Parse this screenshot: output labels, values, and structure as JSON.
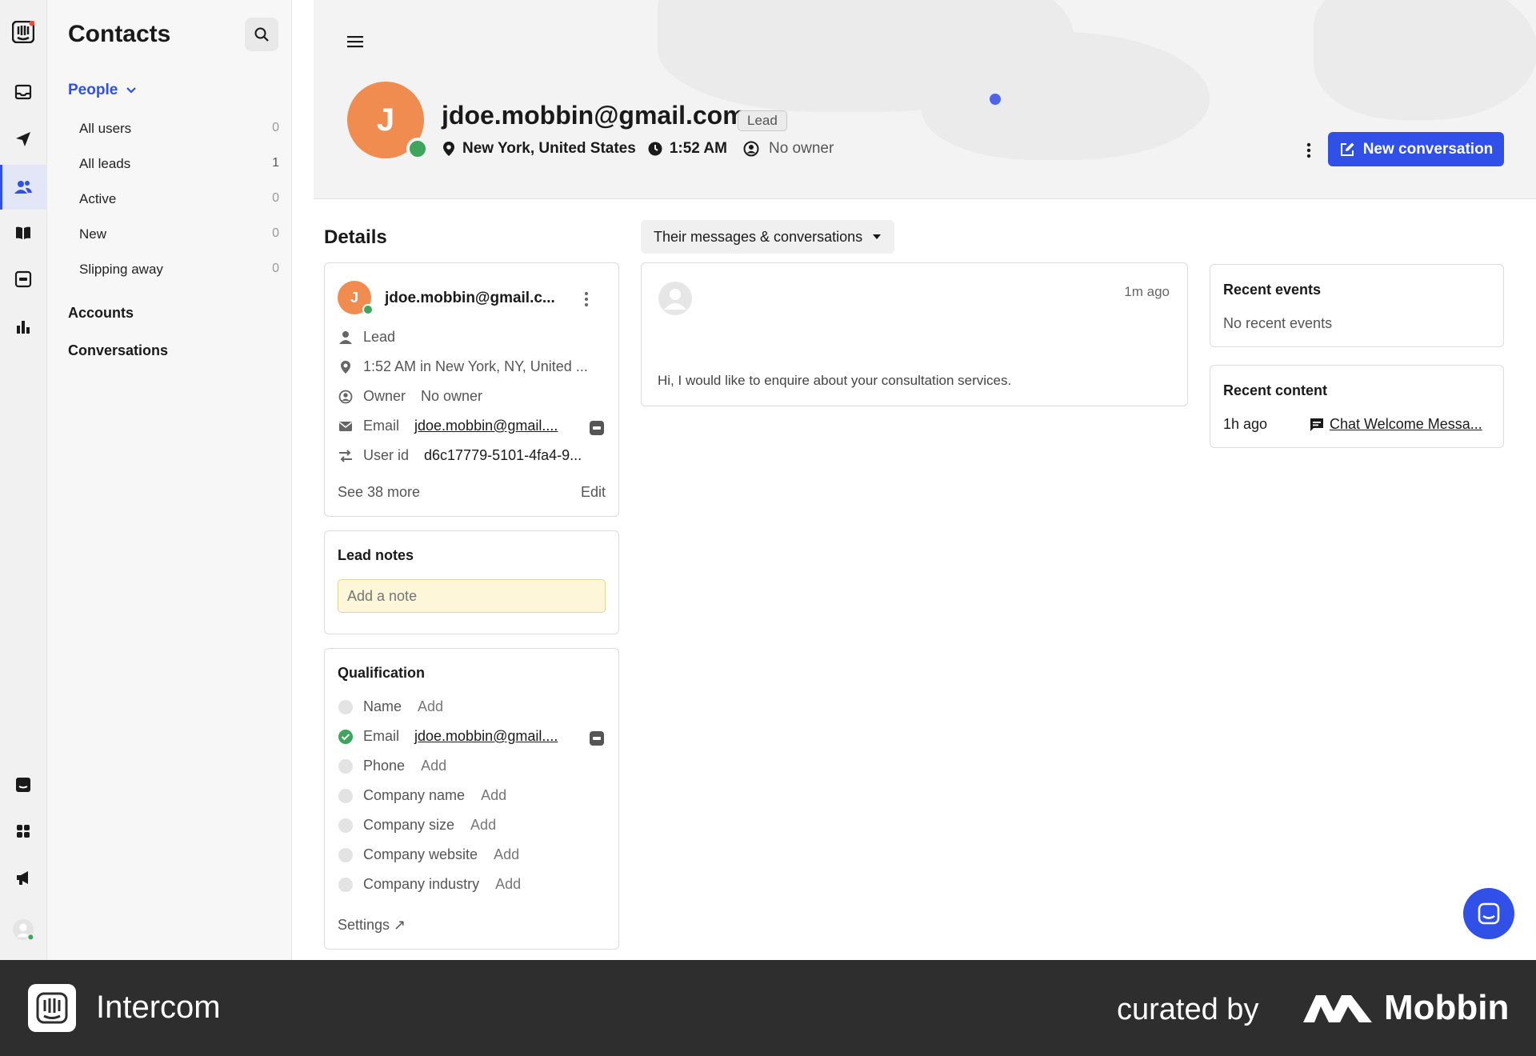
{
  "sidebar": {
    "title": "Contacts",
    "people_label": "People",
    "items": [
      {
        "label": "All users",
        "count": "0"
      },
      {
        "label": "All leads",
        "count": "1"
      },
      {
        "label": "Active",
        "count": "0"
      },
      {
        "label": "New",
        "count": "0"
      },
      {
        "label": "Slipping away",
        "count": "0"
      }
    ],
    "sections": [
      "Accounts",
      "Conversations"
    ]
  },
  "header": {
    "avatar_initial": "J",
    "email": "jdoe.mobbin@gmail.com",
    "badge": "Lead",
    "location": "New York, United States",
    "time": "1:52 AM",
    "owner": "No owner",
    "new_conversation": "New conversation"
  },
  "details": {
    "title": "Details",
    "card": {
      "initial": "J",
      "name": "jdoe.mobbin@gmail.c...",
      "type": "Lead",
      "location": "1:52 AM in New York, NY, United ...",
      "owner_label": "Owner",
      "owner_value": "No owner",
      "email_label": "Email",
      "email_value": "jdoe.mobbin@gmail....",
      "userid_label": "User id",
      "userid_value": "d6c17779-5101-4fa4-9...",
      "see_more": "See 38 more",
      "edit": "Edit"
    },
    "notes": {
      "title": "Lead notes",
      "placeholder": "Add a note"
    },
    "qualification": {
      "title": "Qualification",
      "rows": [
        {
          "label": "Name",
          "value": "Add"
        },
        {
          "label": "Email",
          "value": "jdoe.mobbin@gmail...."
        },
        {
          "label": "Phone",
          "value": "Add"
        },
        {
          "label": "Company name",
          "value": "Add"
        },
        {
          "label": "Company size",
          "value": "Add"
        },
        {
          "label": "Company website",
          "value": "Add"
        },
        {
          "label": "Company industry",
          "value": "Add"
        }
      ],
      "settings": "Settings ↗"
    }
  },
  "messages": {
    "filter": "Their messages & conversations",
    "items": [
      {
        "time": "1m ago",
        "text": "Hi, I would like to enquire about your consultation services."
      }
    ]
  },
  "recent_events": {
    "title": "Recent events",
    "empty": "No recent events"
  },
  "recent_content": {
    "title": "Recent content",
    "time": "1h ago",
    "item": "Chat Welcome Messa..."
  },
  "footer": {
    "brand": "Intercom",
    "curated": "curated by",
    "mobbin": "Mobbin"
  },
  "colors": {
    "accent": "#3050e8",
    "avatar": "#f08c4f",
    "online": "#3fa55c",
    "note_bg": "#fdf6d8"
  }
}
